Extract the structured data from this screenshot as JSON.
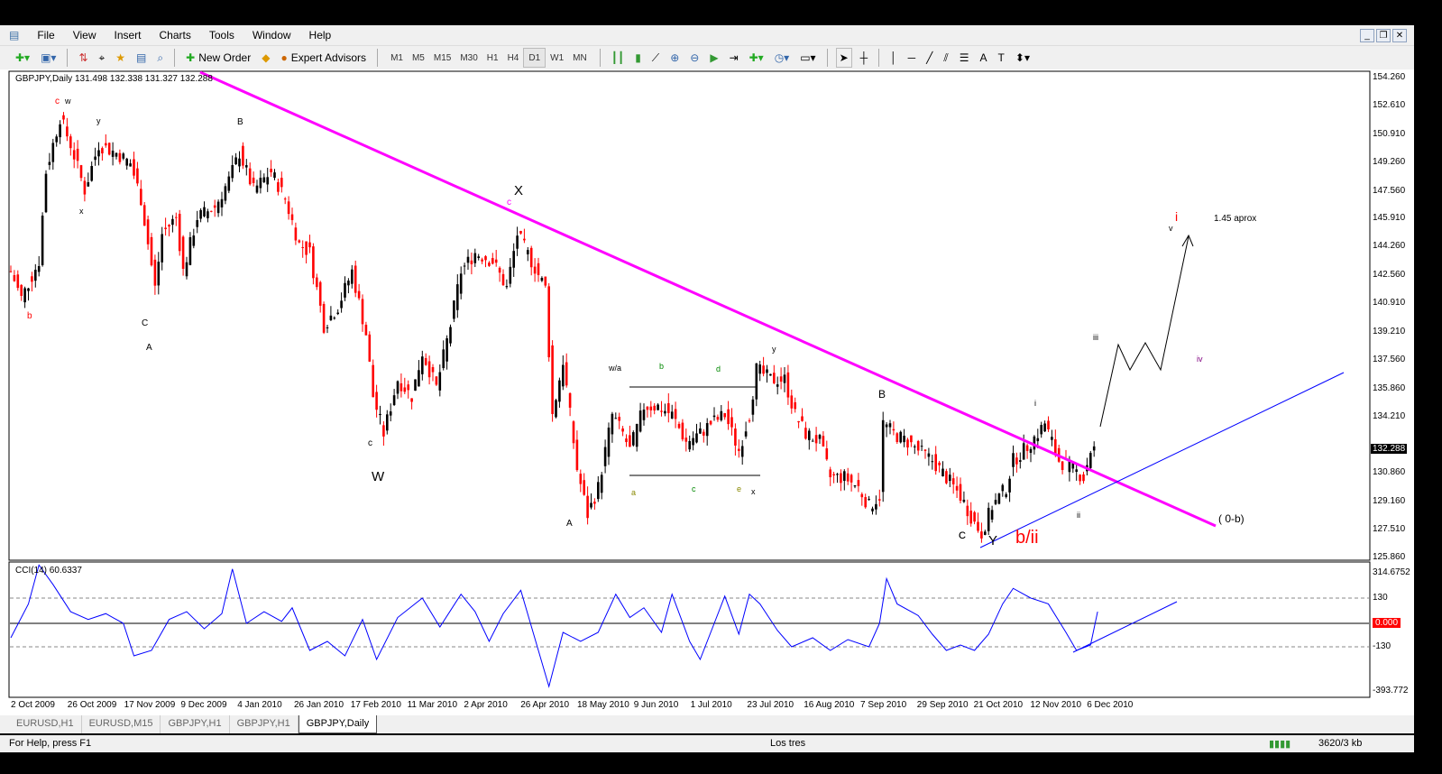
{
  "menu": [
    "File",
    "View",
    "Insert",
    "Charts",
    "Tools",
    "Window",
    "Help"
  ],
  "toolbar": {
    "new_order": "New Order",
    "expert_advisors": "Expert Advisors",
    "timeframes": [
      "M1",
      "M5",
      "M15",
      "M30",
      "H1",
      "H4",
      "D1",
      "W1",
      "MN"
    ],
    "active_timeframe": "D1"
  },
  "window_controls": [
    "_",
    "❐",
    "✕"
  ],
  "chart": {
    "header": "GBPJPY,Daily  131.498 132.338 131.327 132.288",
    "current_price": "132.288",
    "price_ticks": [
      "154.260",
      "152.610",
      "150.910",
      "149.260",
      "147.560",
      "145.910",
      "144.260",
      "142.560",
      "140.910",
      "139.210",
      "137.560",
      "135.860",
      "134.210",
      "130.860",
      "129.160",
      "127.510",
      "125.860"
    ],
    "cci_header": "CCI(14) 60.6337",
    "cci_ticks": [
      "314.6752",
      "130",
      "0.000",
      "-130",
      "-393.772"
    ],
    "date_ticks": [
      "2 Oct 2009",
      "26 Oct 2009",
      "17 Nov 2009",
      "9 Dec 2009",
      "4 Jan 2010",
      "26 Jan 2010",
      "17 Feb 2010",
      "11 Mar 2010",
      "2 Apr 2010",
      "26 Apr 2010",
      "18 May 2010",
      "9 Jun 2010",
      "1 Jul 2010",
      "23 Jul 2010",
      "16 Aug 2010",
      "7 Sep 2010",
      "29 Sep 2010",
      "21 Oct 2010",
      "12 Nov 2010",
      "6 Dec 2010"
    ],
    "annotations": [
      "c",
      "w",
      "b",
      "y",
      "x",
      "C",
      "A",
      "B",
      "c",
      "W",
      "X",
      "c",
      "C",
      "A",
      "w/a",
      "b",
      "d",
      "a",
      "c",
      "e",
      "x",
      "y",
      "B",
      "C",
      "Y",
      "b/ii",
      "i",
      "ii",
      "iii",
      "iv",
      "v",
      "i",
      "1.45 aprox",
      "( 0-b)"
    ]
  },
  "chart_data": {
    "type": "candlestick",
    "title": "GBPJPY,Daily",
    "ylim": [
      125.86,
      154.26
    ],
    "x_unit": "trading days since 2 Oct 2009",
    "points": [
      [
        0,
        142.8
      ],
      [
        3,
        141.2
      ],
      [
        8,
        143.4
      ],
      [
        10,
        148.7
      ],
      [
        14,
        151.9
      ],
      [
        17,
        150.3
      ],
      [
        21,
        147.6
      ],
      [
        25,
        150.3
      ],
      [
        30,
        149.8
      ],
      [
        34,
        149.2
      ],
      [
        37,
        147.1
      ],
      [
        41,
        141.8
      ],
      [
        43,
        145
      ],
      [
        47,
        146
      ],
      [
        49,
        142.8
      ],
      [
        53,
        146
      ],
      [
        58,
        146.6
      ],
      [
        62,
        148.2
      ],
      [
        65,
        149.8
      ],
      [
        69,
        147.6
      ],
      [
        74,
        148.7
      ],
      [
        78,
        147.1
      ],
      [
        82,
        144.4
      ],
      [
        85,
        143.9
      ],
      [
        89,
        139.6
      ],
      [
        93,
        140.7
      ],
      [
        97,
        142.8
      ],
      [
        101,
        139.1
      ],
      [
        103,
        135.4
      ],
      [
        106,
        133.2
      ],
      [
        110,
        136.4
      ],
      [
        114,
        135.4
      ],
      [
        117,
        138
      ],
      [
        121,
        135.9
      ],
      [
        125,
        139.6
      ],
      [
        128,
        142.8
      ],
      [
        132,
        143.9
      ],
      [
        137,
        143.4
      ],
      [
        141,
        141.8
      ],
      [
        144,
        145
      ],
      [
        148,
        143.4
      ],
      [
        152,
        141.8
      ],
      [
        154,
        134.3
      ],
      [
        157,
        137.5
      ],
      [
        161,
        131.1
      ],
      [
        164,
        128.4
      ],
      [
        167,
        130
      ],
      [
        171,
        134.3
      ],
      [
        174,
        133.2
      ],
      [
        176,
        132.2
      ],
      [
        180,
        134.8
      ],
      [
        184,
        134.8
      ],
      [
        188,
        134.3
      ],
      [
        192,
        132.7
      ],
      [
        196,
        133.2
      ],
      [
        199,
        133.8
      ],
      [
        203,
        134.3
      ],
      [
        207,
        132.2
      ],
      [
        210,
        134.3
      ],
      [
        212,
        137
      ],
      [
        216,
        136.4
      ],
      [
        220,
        136.4
      ],
      [
        223,
        134.3
      ],
      [
        226,
        133.2
      ],
      [
        230,
        132.7
      ],
      [
        233,
        130.6
      ],
      [
        237,
        130.6
      ],
      [
        241,
        130
      ],
      [
        244,
        128.9
      ],
      [
        247,
        129.5
      ],
      [
        248,
        133.8
      ],
      [
        251,
        133.2
      ],
      [
        255,
        132.7
      ],
      [
        258,
        132.2
      ],
      [
        262,
        131.6
      ],
      [
        266,
        130.6
      ],
      [
        270,
        129.5
      ],
      [
        274,
        127.9
      ],
      [
        276,
        127.3
      ],
      [
        279,
        128.9
      ],
      [
        283,
        130
      ],
      [
        285,
        131.6
      ],
      [
        288,
        132.2
      ],
      [
        292,
        133.2
      ],
      [
        294,
        133.8
      ],
      [
        298,
        131.6
      ],
      [
        302,
        131.1
      ],
      [
        305,
        130.6
      ],
      [
        307,
        132.2
      ],
      [
        308,
        132.288
      ]
    ],
    "cci": {
      "name": "CCI(14)",
      "ylim": [
        -393.772,
        314.6752
      ],
      "levels": [
        130,
        0,
        -130
      ],
      "points": [
        [
          0,
          -80
        ],
        [
          5,
          100
        ],
        [
          8,
          300
        ],
        [
          12,
          200
        ],
        [
          17,
          60
        ],
        [
          22,
          20
        ],
        [
          27,
          50
        ],
        [
          32,
          0
        ],
        [
          35,
          -180
        ],
        [
          40,
          -150
        ],
        [
          45,
          20
        ],
        [
          50,
          60
        ],
        [
          55,
          -30
        ],
        [
          60,
          50
        ],
        [
          63,
          280
        ],
        [
          67,
          0
        ],
        [
          72,
          60
        ],
        [
          77,
          10
        ],
        [
          80,
          80
        ],
        [
          85,
          -150
        ],
        [
          90,
          -100
        ],
        [
          95,
          -180
        ],
        [
          100,
          20
        ],
        [
          104,
          -200
        ],
        [
          110,
          30
        ],
        [
          117,
          130
        ],
        [
          122,
          -20
        ],
        [
          128,
          150
        ],
        [
          132,
          60
        ],
        [
          136,
          -100
        ],
        [
          140,
          50
        ],
        [
          145,
          170
        ],
        [
          150,
          -150
        ],
        [
          153,
          -350
        ],
        [
          157,
          -50
        ],
        [
          162,
          -100
        ],
        [
          167,
          -50
        ],
        [
          172,
          150
        ],
        [
          176,
          30
        ],
        [
          180,
          80
        ],
        [
          185,
          -50
        ],
        [
          188,
          150
        ],
        [
          193,
          -100
        ],
        [
          196,
          -200
        ],
        [
          200,
          0
        ],
        [
          203,
          140
        ],
        [
          207,
          -60
        ],
        [
          210,
          150
        ],
        [
          213,
          100
        ],
        [
          218,
          -40
        ],
        [
          222,
          -130
        ],
        [
          228,
          -80
        ],
        [
          233,
          -150
        ],
        [
          238,
          -90
        ],
        [
          244,
          -130
        ],
        [
          247,
          0
        ],
        [
          249,
          230
        ],
        [
          252,
          100
        ],
        [
          258,
          40
        ],
        [
          262,
          -60
        ],
        [
          266,
          -150
        ],
        [
          270,
          -120
        ],
        [
          274,
          -150
        ],
        [
          278,
          -60
        ],
        [
          282,
          100
        ],
        [
          285,
          180
        ],
        [
          290,
          130
        ],
        [
          295,
          100
        ],
        [
          300,
          -50
        ],
        [
          303,
          -150
        ],
        [
          307,
          -120
        ],
        [
          309,
          60
        ]
      ]
    }
  },
  "tabs": [
    "EURUSD,H1",
    "EURUSD,M15",
    "GBPJPY,H1",
    "GBPJPY,H1",
    "GBPJPY,Daily"
  ],
  "active_tab": "GBPJPY,Daily",
  "status": {
    "help": "For Help, press F1",
    "profile": "Los tres",
    "traffic": "3620/3 kb"
  },
  "colors": {
    "bull": "#000000",
    "bear": "#ff0000",
    "trendline": "#ff00ff",
    "cci": "#0000ff",
    "zero": "#ff0000"
  }
}
